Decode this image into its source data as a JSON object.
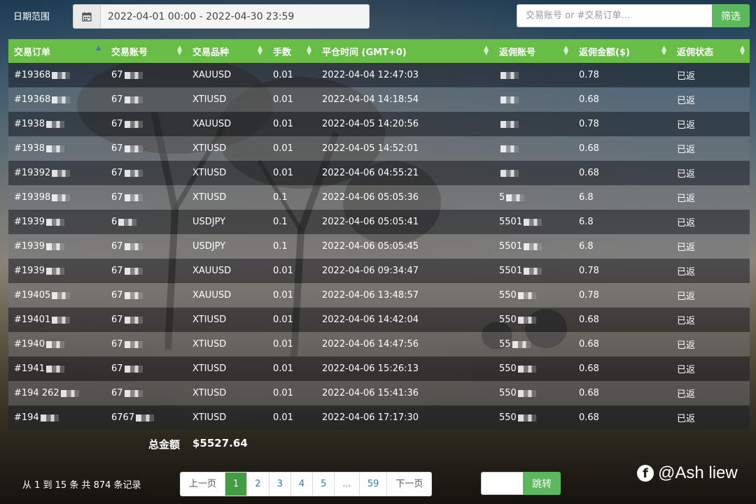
{
  "filters": {
    "date_label": "日期范围",
    "date_range_value": "2022-04-01 00:00 - 2022-04-30 23:59",
    "search_placeholder": "交易账号 or #交易订单...",
    "filter_button": "筛选"
  },
  "table": {
    "columns": [
      "交易订单",
      "交易账号",
      "交易品种",
      "手数",
      "平仓时间 (GMT+0)",
      "返佣账号",
      "返佣金额($)",
      "返佣状态"
    ],
    "rows": [
      {
        "order": "#19368",
        "account": "67",
        "symbol": "XAUUSD",
        "lots": "0.01",
        "close_time": "2022-04-04 12:47:03",
        "rebate_account": "",
        "rebate_amount": "0.78",
        "status": "已返"
      },
      {
        "order": "#19368",
        "account": "67",
        "symbol": "XTIUSD",
        "lots": "0.01",
        "close_time": "2022-04-04 14:18:54",
        "rebate_account": "",
        "rebate_amount": "0.68",
        "status": "已返"
      },
      {
        "order": "#1938",
        "account": "67",
        "symbol": "XAUUSD",
        "lots": "0.01",
        "close_time": "2022-04-05 14:20:56",
        "rebate_account": "",
        "rebate_amount": "0.78",
        "status": "已返"
      },
      {
        "order": "#1938",
        "account": "67",
        "symbol": "XTIUSD",
        "lots": "0.01",
        "close_time": "2022-04-05 14:52:01",
        "rebate_account": "",
        "rebate_amount": "0.68",
        "status": "已返"
      },
      {
        "order": "#19392",
        "account": "67",
        "symbol": "XTIUSD",
        "lots": "0.01",
        "close_time": "2022-04-06 04:55:21",
        "rebate_account": "",
        "rebate_amount": "0.68",
        "status": "已返"
      },
      {
        "order": "#19398",
        "account": "67",
        "symbol": "XTIUSD",
        "lots": "0.1",
        "close_time": "2022-04-06 05:05:36",
        "rebate_account": "5",
        "rebate_amount": "6.8",
        "status": "已返"
      },
      {
        "order": "#1939",
        "account": "6",
        "symbol": "USDJPY",
        "lots": "0.1",
        "close_time": "2022-04-06 05:05:41",
        "rebate_account": "5501",
        "rebate_amount": "6.8",
        "status": "已返"
      },
      {
        "order": "#1939",
        "account": "67",
        "symbol": "USDJPY",
        "lots": "0.1",
        "close_time": "2022-04-06 05:05:45",
        "rebate_account": "5501",
        "rebate_amount": "6.8",
        "status": "已返"
      },
      {
        "order": "#1939",
        "account": "67",
        "symbol": "XAUUSD",
        "lots": "0.01",
        "close_time": "2022-04-06 09:34:47",
        "rebate_account": "5501",
        "rebate_amount": "0.78",
        "status": "已返"
      },
      {
        "order": "#19405",
        "account": "67",
        "symbol": "XAUUSD",
        "lots": "0.01",
        "close_time": "2022-04-06 13:48:57",
        "rebate_account": "550",
        "rebate_amount": "0.78",
        "status": "已返"
      },
      {
        "order": "#19401",
        "account": "67",
        "symbol": "XTIUSD",
        "lots": "0.01",
        "close_time": "2022-04-06 14:42:04",
        "rebate_account": "550",
        "rebate_amount": "0.68",
        "status": "已返"
      },
      {
        "order": "#1940",
        "account": "67",
        "symbol": "XTIUSD",
        "lots": "0.01",
        "close_time": "2022-04-06 14:47:56",
        "rebate_account": "55",
        "rebate_amount": "0.68",
        "status": "已返"
      },
      {
        "order": "#1941",
        "account": "67",
        "symbol": "XTIUSD",
        "lots": "0.01",
        "close_time": "2022-04-06 15:26:13",
        "rebate_account": "550",
        "rebate_amount": "0.68",
        "status": "已返"
      },
      {
        "order": "#194 262",
        "account": "67",
        "symbol": "XTIUSD",
        "lots": "0.01",
        "close_time": "2022-04-06 15:41:36",
        "rebate_account": "550",
        "rebate_amount": "0.68",
        "status": "已返"
      },
      {
        "order": "#194",
        "account": "6767",
        "symbol": "XTIUSD",
        "lots": "0.01",
        "close_time": "2022-04-06 17:17:30",
        "rebate_account": "550",
        "rebate_amount": "0.68",
        "status": "已返"
      }
    ]
  },
  "summary": {
    "total_label": "总金额",
    "total_value": "$5527.64"
  },
  "pagination": {
    "info": "从 1 到 15 条 共 874 条记录",
    "prev": "上一页",
    "next": "下一页",
    "pages": [
      "1",
      "2",
      "3",
      "4",
      "5",
      "...",
      "59"
    ],
    "current": "1",
    "jump_button": "跳转"
  },
  "watermark": {
    "logo": "f",
    "text": "@Ash liew"
  },
  "colors": {
    "header_green": "#67bd45",
    "button_green": "#5cb85c",
    "active_page": "#449d44"
  }
}
